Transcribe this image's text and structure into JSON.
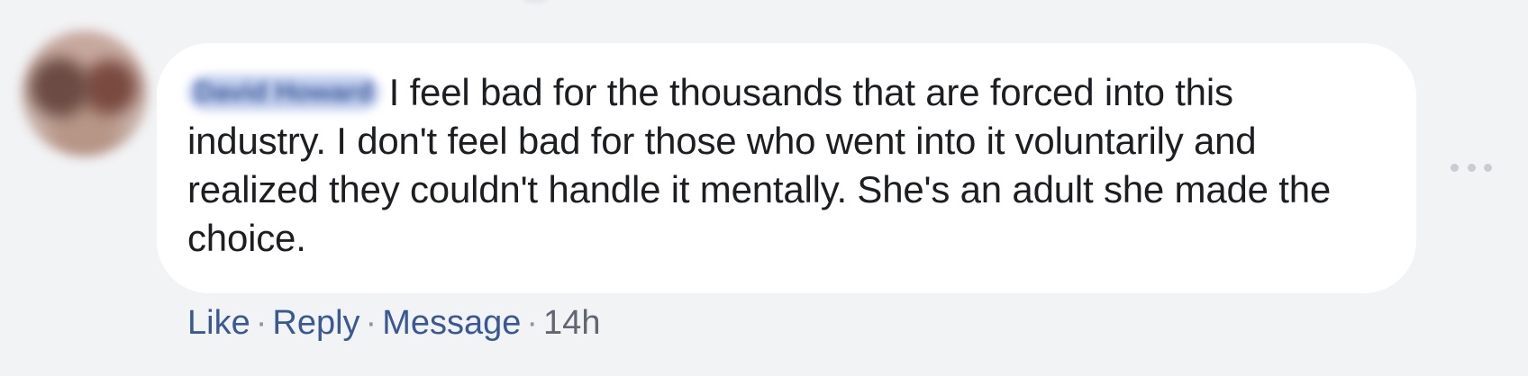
{
  "comment": {
    "author_name": "David Howard",
    "text": "I feel bad for the thousands that are forced into this industry. I don't feel bad for those who went into it voluntarily and realized they couldn't handle it mentally. She's an adult she made the choice."
  },
  "actions": {
    "like": "Like",
    "reply": "Reply",
    "message": "Message",
    "separator": "·",
    "timestamp": "14h"
  }
}
